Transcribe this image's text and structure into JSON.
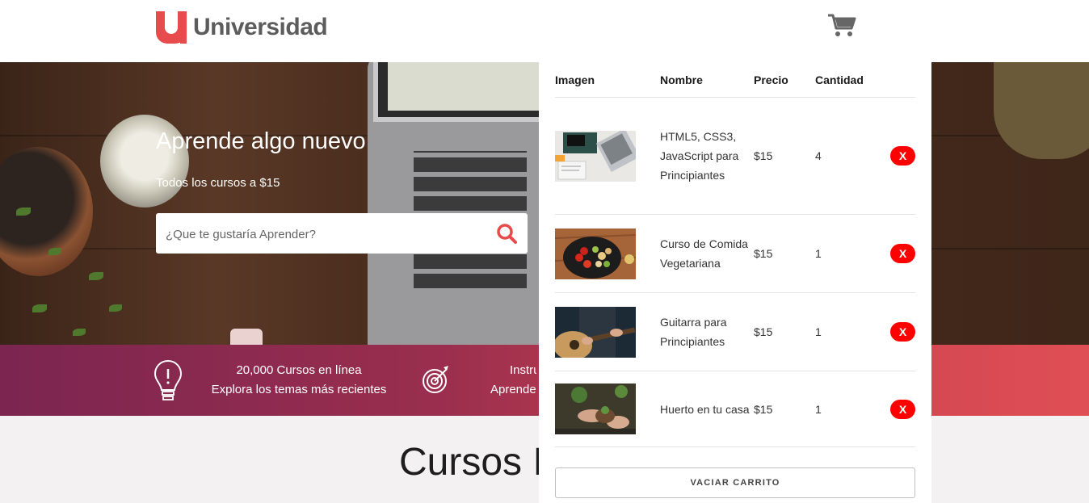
{
  "header": {
    "logo_letter": "u",
    "logo_text": "Universidad"
  },
  "hero": {
    "title": "Aprende algo nuevo",
    "subtitle": "Todos los cursos a $15",
    "search_placeholder": "¿Que te gustaría Aprender?"
  },
  "bar": {
    "items": [
      {
        "icon": "lightbulb-icon",
        "line1": "20,000 Cursos en línea",
        "line2": "Explora los temas más recientes"
      },
      {
        "icon": "target-icon",
        "line1": "Instru",
        "line2": "Aprende"
      }
    ]
  },
  "courses": {
    "title": "Cursos I"
  },
  "cart": {
    "headers": [
      "Imagen",
      "Nombre",
      "Precio",
      "Cantidad"
    ],
    "items": [
      {
        "name": "HTML5, CSS3, JavaScript para Principiantes",
        "price": "$15",
        "qty": "4",
        "remove": "X",
        "thumb": "laptop-desk-thumb"
      },
      {
        "name": "Curso de Comida Vegetariana",
        "price": "$15",
        "qty": "1",
        "remove": "X",
        "thumb": "vegetables-thumb"
      },
      {
        "name": "Guitarra para Principiantes",
        "price": "$15",
        "qty": "1",
        "remove": "X",
        "thumb": "guitar-thumb"
      },
      {
        "name": "Huerto en tu casa",
        "price": "$15",
        "qty": "1",
        "remove": "X",
        "thumb": "garden-thumb"
      }
    ],
    "empty_label": "VACIAR CARRITO"
  },
  "colors": {
    "brand": "#e84b4b",
    "remove_button": "#ff0000",
    "bar_start": "#7b2550",
    "bar_end": "#e04e55"
  }
}
